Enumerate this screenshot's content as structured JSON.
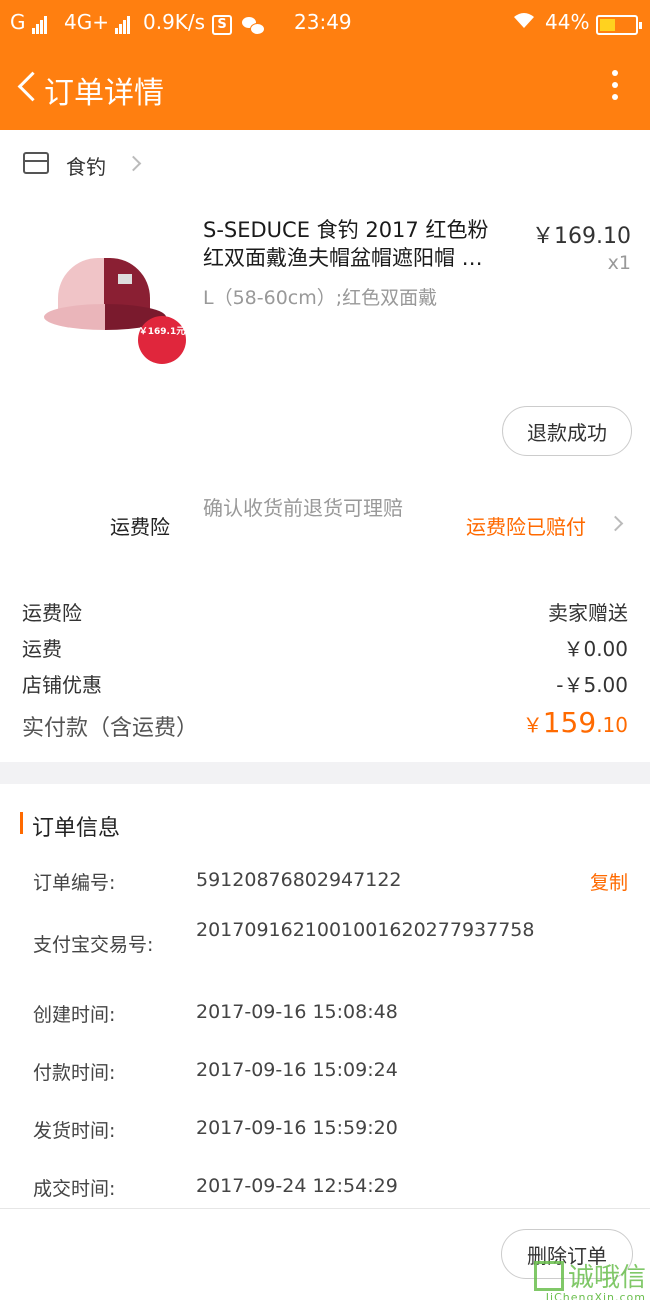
{
  "status_bar": {
    "carrier1": "G",
    "carrier2": "4G+",
    "net_speed": "0.9K/s",
    "s_icon": "S",
    "time": "23:49",
    "battery": "44%",
    "battery_level": 0.44
  },
  "header": {
    "title": "订单详情",
    "back_icon": "back-arrow-icon",
    "more_icon": "more-vertical-icon"
  },
  "shop": {
    "name": "食钓",
    "icon": "store-icon"
  },
  "product": {
    "title_line1": "S-SEDUCE 食钓 2017 红色粉",
    "title_line2": "红双面戴渔夫帽盆帽遮阳帽 …",
    "sku": "L（58-60cm）;红色双面戴",
    "price": "￥169.10",
    "qty": "x1",
    "badge_price": "￥169.1元",
    "refund_button": "退款成功"
  },
  "insurance": {
    "label": "运费险",
    "desc": "确认收货前退货可理赔",
    "status": "运费险已赔付"
  },
  "costs": [
    {
      "label": "运费险",
      "value": "卖家赠送"
    },
    {
      "label": "运费",
      "value": "￥0.00"
    },
    {
      "label": "店铺优惠",
      "value": "-￥5.00"
    }
  ],
  "paid": {
    "label": "实付款（含运费）",
    "currency": "￥",
    "integer": "159",
    "decimal": ".10"
  },
  "order_info": {
    "title": "订单信息",
    "copy_label": "复制",
    "rows": [
      {
        "label": "订单编号:",
        "value": "59120876802947122"
      },
      {
        "label": "支付宝交易号:",
        "value": "2017091621001001620277937758"
      },
      {
        "label": "创建时间:",
        "value": "2017-09-16 15:08:48"
      },
      {
        "label": "付款时间:",
        "value": "2017-09-16 15:09:24"
      },
      {
        "label": "发货时间:",
        "value": "2017-09-16 15:59:20"
      },
      {
        "label": "成交时间:",
        "value": "2017-09-24 12:54:29"
      }
    ]
  },
  "bottom": {
    "delete_button": "删除订单"
  },
  "watermark": {
    "text": "诚哦信",
    "sub": "JiChengXin.com"
  },
  "colors": {
    "brand": "#ff7f10",
    "accent": "#ff6a00"
  }
}
